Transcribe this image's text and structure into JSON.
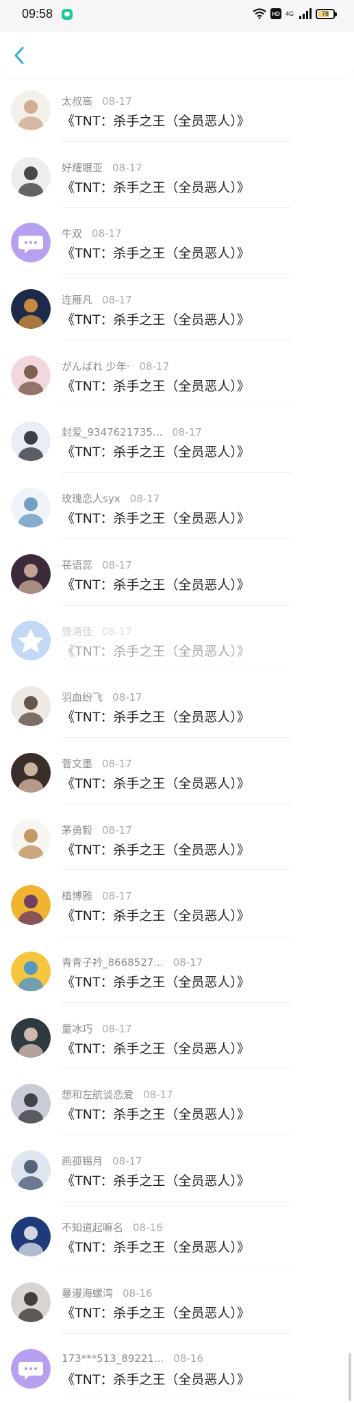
{
  "status_bar": {
    "time": "09:58",
    "hd": "HD",
    "network_top": "4G",
    "network_bottom": "ill",
    "battery_level": "78",
    "battery_fraction": 0.78
  },
  "header": {
    "back_icon": "chevron-left-icon",
    "accent_color": "#2fb3c9"
  },
  "items": [
    {
      "name": "太叔高",
      "date": "08-17",
      "title": "《TNT：杀手之王（全员恶人）》",
      "avatar": {
        "bg": "#f3efe9",
        "fg": "#c9a283"
      }
    },
    {
      "name": "好耀眼亚",
      "date": "08-17",
      "title": "《TNT：杀手之王（全员恶人）》",
      "avatar": {
        "bg": "#eeeeee",
        "fg": "#2a2a2a"
      }
    },
    {
      "name": "牛双",
      "date": "08-17",
      "title": "《TNT：杀手之王（全员恶人）》",
      "avatar": {
        "bg": "#b8a0f0",
        "fg": "#ffffff",
        "chat": true
      }
    },
    {
      "name": "连雁凡",
      "date": "08-17",
      "title": "《TNT：杀手之王（全员恶人）》",
      "avatar": {
        "bg": "#1d2a4a",
        "fg": "#e59a3a"
      }
    },
    {
      "name": "がんばれ 少年·",
      "date": "08-17",
      "title": "《TNT：杀手之王（全员恶人）》",
      "avatar": {
        "bg": "#f2d7de",
        "fg": "#6a4a3a"
      }
    },
    {
      "name": "封爱_9347621735...",
      "date": "08-17",
      "title": "《TNT：杀手之王（全员恶人）》",
      "avatar": {
        "bg": "#e9edf5",
        "fg": "#1f1f2a"
      }
    },
    {
      "name": "玫瑰恋人syx",
      "date": "08-17",
      "title": "《TNT：杀手之王（全员恶人）》",
      "avatar": {
        "bg": "#eef4fa",
        "fg": "#5a8fb8"
      }
    },
    {
      "name": "苌语蕊",
      "date": "08-17",
      "title": "《TNT：杀手之王（全员恶人）》",
      "avatar": {
        "bg": "#3a2a3a",
        "fg": "#d9b8a0"
      }
    },
    {
      "name": "暨清佳",
      "date": "08-17",
      "title": "《TNT：杀手之王（全员恶人）》",
      "dim": true,
      "avatar": {
        "bg": "#6aa0e8",
        "fg": "#ffffff",
        "logo": true
      }
    },
    {
      "name": "羽血纷飞",
      "date": "08-17",
      "title": "《TNT：杀手之王（全员恶人）》",
      "avatar": {
        "bg": "#efe9e6",
        "fg": "#4a3a34"
      }
    },
    {
      "name": "菅文墨",
      "date": "08-17",
      "title": "《TNT：杀手之王（全员恶人）》",
      "avatar": {
        "bg": "#3a2e2a",
        "fg": "#e9c9b5"
      }
    },
    {
      "name": "茅勇毅",
      "date": "08-17",
      "title": "《TNT：杀手之王（全员恶人）》",
      "avatar": {
        "bg": "#f7f5f0",
        "fg": "#b8864a"
      }
    },
    {
      "name": "植博雅",
      "date": "08-17",
      "title": "《TNT：杀手之王（全员恶人）》",
      "avatar": {
        "bg": "#f0b430",
        "fg": "#5a2a6a"
      }
    },
    {
      "name": "青青子衿_8668527...",
      "date": "08-17",
      "title": "《TNT：杀手之王（全员恶人）》",
      "avatar": {
        "bg": "#f5c540",
        "fg": "#3a8fd9"
      }
    },
    {
      "name": "童冰巧",
      "date": "08-17",
      "title": "《TNT：杀手之王（全员恶人）》",
      "avatar": {
        "bg": "#2f3a40",
        "fg": "#e9d0c5"
      }
    },
    {
      "name": "想和左航谈恋爱",
      "date": "08-17",
      "title": "《TNT：杀手之王（全员恶人）》",
      "avatar": {
        "bg": "#c9ccd6",
        "fg": "#2a2a30"
      }
    },
    {
      "name": "画孤锡月",
      "date": "08-17",
      "title": "《TNT：杀手之王（全员恶人）》",
      "avatar": {
        "bg": "#e0e6ef",
        "fg": "#3a4a6a"
      }
    },
    {
      "name": "不知道起嘛名",
      "date": "08-16",
      "title": "《TNT：杀手之王（全员恶人）》",
      "avatar": {
        "bg": "#1f3a7a",
        "fg": "#f2f2f2"
      }
    },
    {
      "name": "蔓漫海螺湾",
      "date": "08-16",
      "title": "《TNT：杀手之王（全员恶人）》",
      "avatar": {
        "bg": "#d9d4cf",
        "fg": "#2a2220"
      }
    },
    {
      "name": "173***513_89221...",
      "date": "08-16",
      "title": "《TNT：杀手之王（全员恶人）》",
      "avatar": {
        "bg": "#b8a0f0",
        "fg": "#ffffff",
        "chat": true
      }
    }
  ]
}
